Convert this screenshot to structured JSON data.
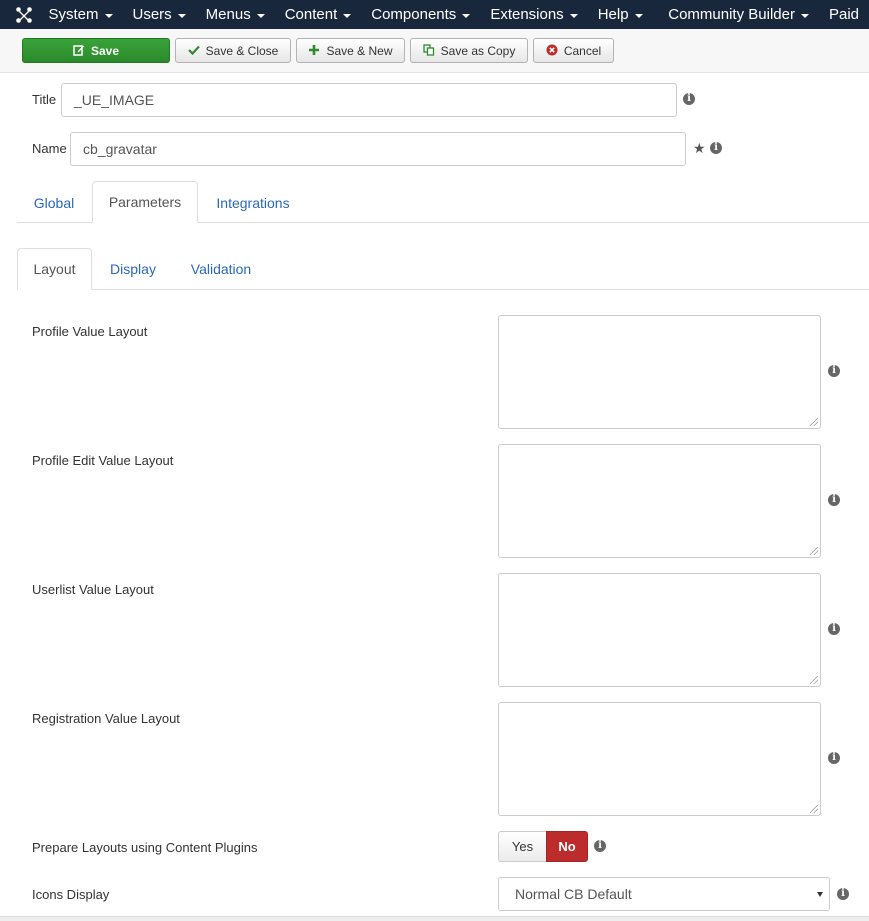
{
  "navbar": {
    "logo": "joomla-logo-icon",
    "items": [
      {
        "label": "System"
      },
      {
        "label": "Users"
      },
      {
        "label": "Menus"
      },
      {
        "label": "Content"
      },
      {
        "label": "Components"
      },
      {
        "label": "Extensions"
      },
      {
        "label": "Help"
      },
      {
        "label": "Community Builder"
      },
      {
        "label": "Paid"
      }
    ]
  },
  "toolbar": {
    "save": {
      "label": "Save",
      "icon": "edit-icon"
    },
    "save_close": {
      "label": "Save & Close",
      "icon": "checkmark-icon"
    },
    "save_new": {
      "label": "Save & New",
      "icon": "plus-icon"
    },
    "save_copy": {
      "label": "Save as Copy",
      "icon": "copy-icon"
    },
    "cancel": {
      "label": "Cancel",
      "icon": "cancel-circle-icon"
    }
  },
  "form": {
    "title_label": "Title",
    "title_value": "_UE_IMAGE",
    "name_label": "Name",
    "name_value": "cb_gravatar"
  },
  "main_tabs": [
    {
      "label": "Global"
    },
    {
      "label": "Parameters",
      "active": true
    },
    {
      "label": "Integrations"
    }
  ],
  "sub_tabs": [
    {
      "label": "Layout",
      "active": true
    },
    {
      "label": "Display"
    },
    {
      "label": "Validation"
    }
  ],
  "params": {
    "profile_value_layout": {
      "label": "Profile Value Layout",
      "value": ""
    },
    "profile_edit_value_layout": {
      "label": "Profile Edit Value Layout",
      "value": ""
    },
    "userlist_value_layout": {
      "label": "Userlist Value Layout",
      "value": ""
    },
    "registration_value_layout": {
      "label": "Registration Value Layout",
      "value": ""
    },
    "prepare_layouts": {
      "label": "Prepare Layouts using Content Plugins",
      "yes": "Yes",
      "no": "No",
      "selected": "No"
    },
    "icons_display": {
      "label": "Icons Display",
      "selected": "Normal CB Default"
    }
  },
  "colors": {
    "navbar": "#19273c",
    "save_green": "#2f932f",
    "no_red": "#bd2c2c",
    "link_blue": "#2a69b8"
  }
}
